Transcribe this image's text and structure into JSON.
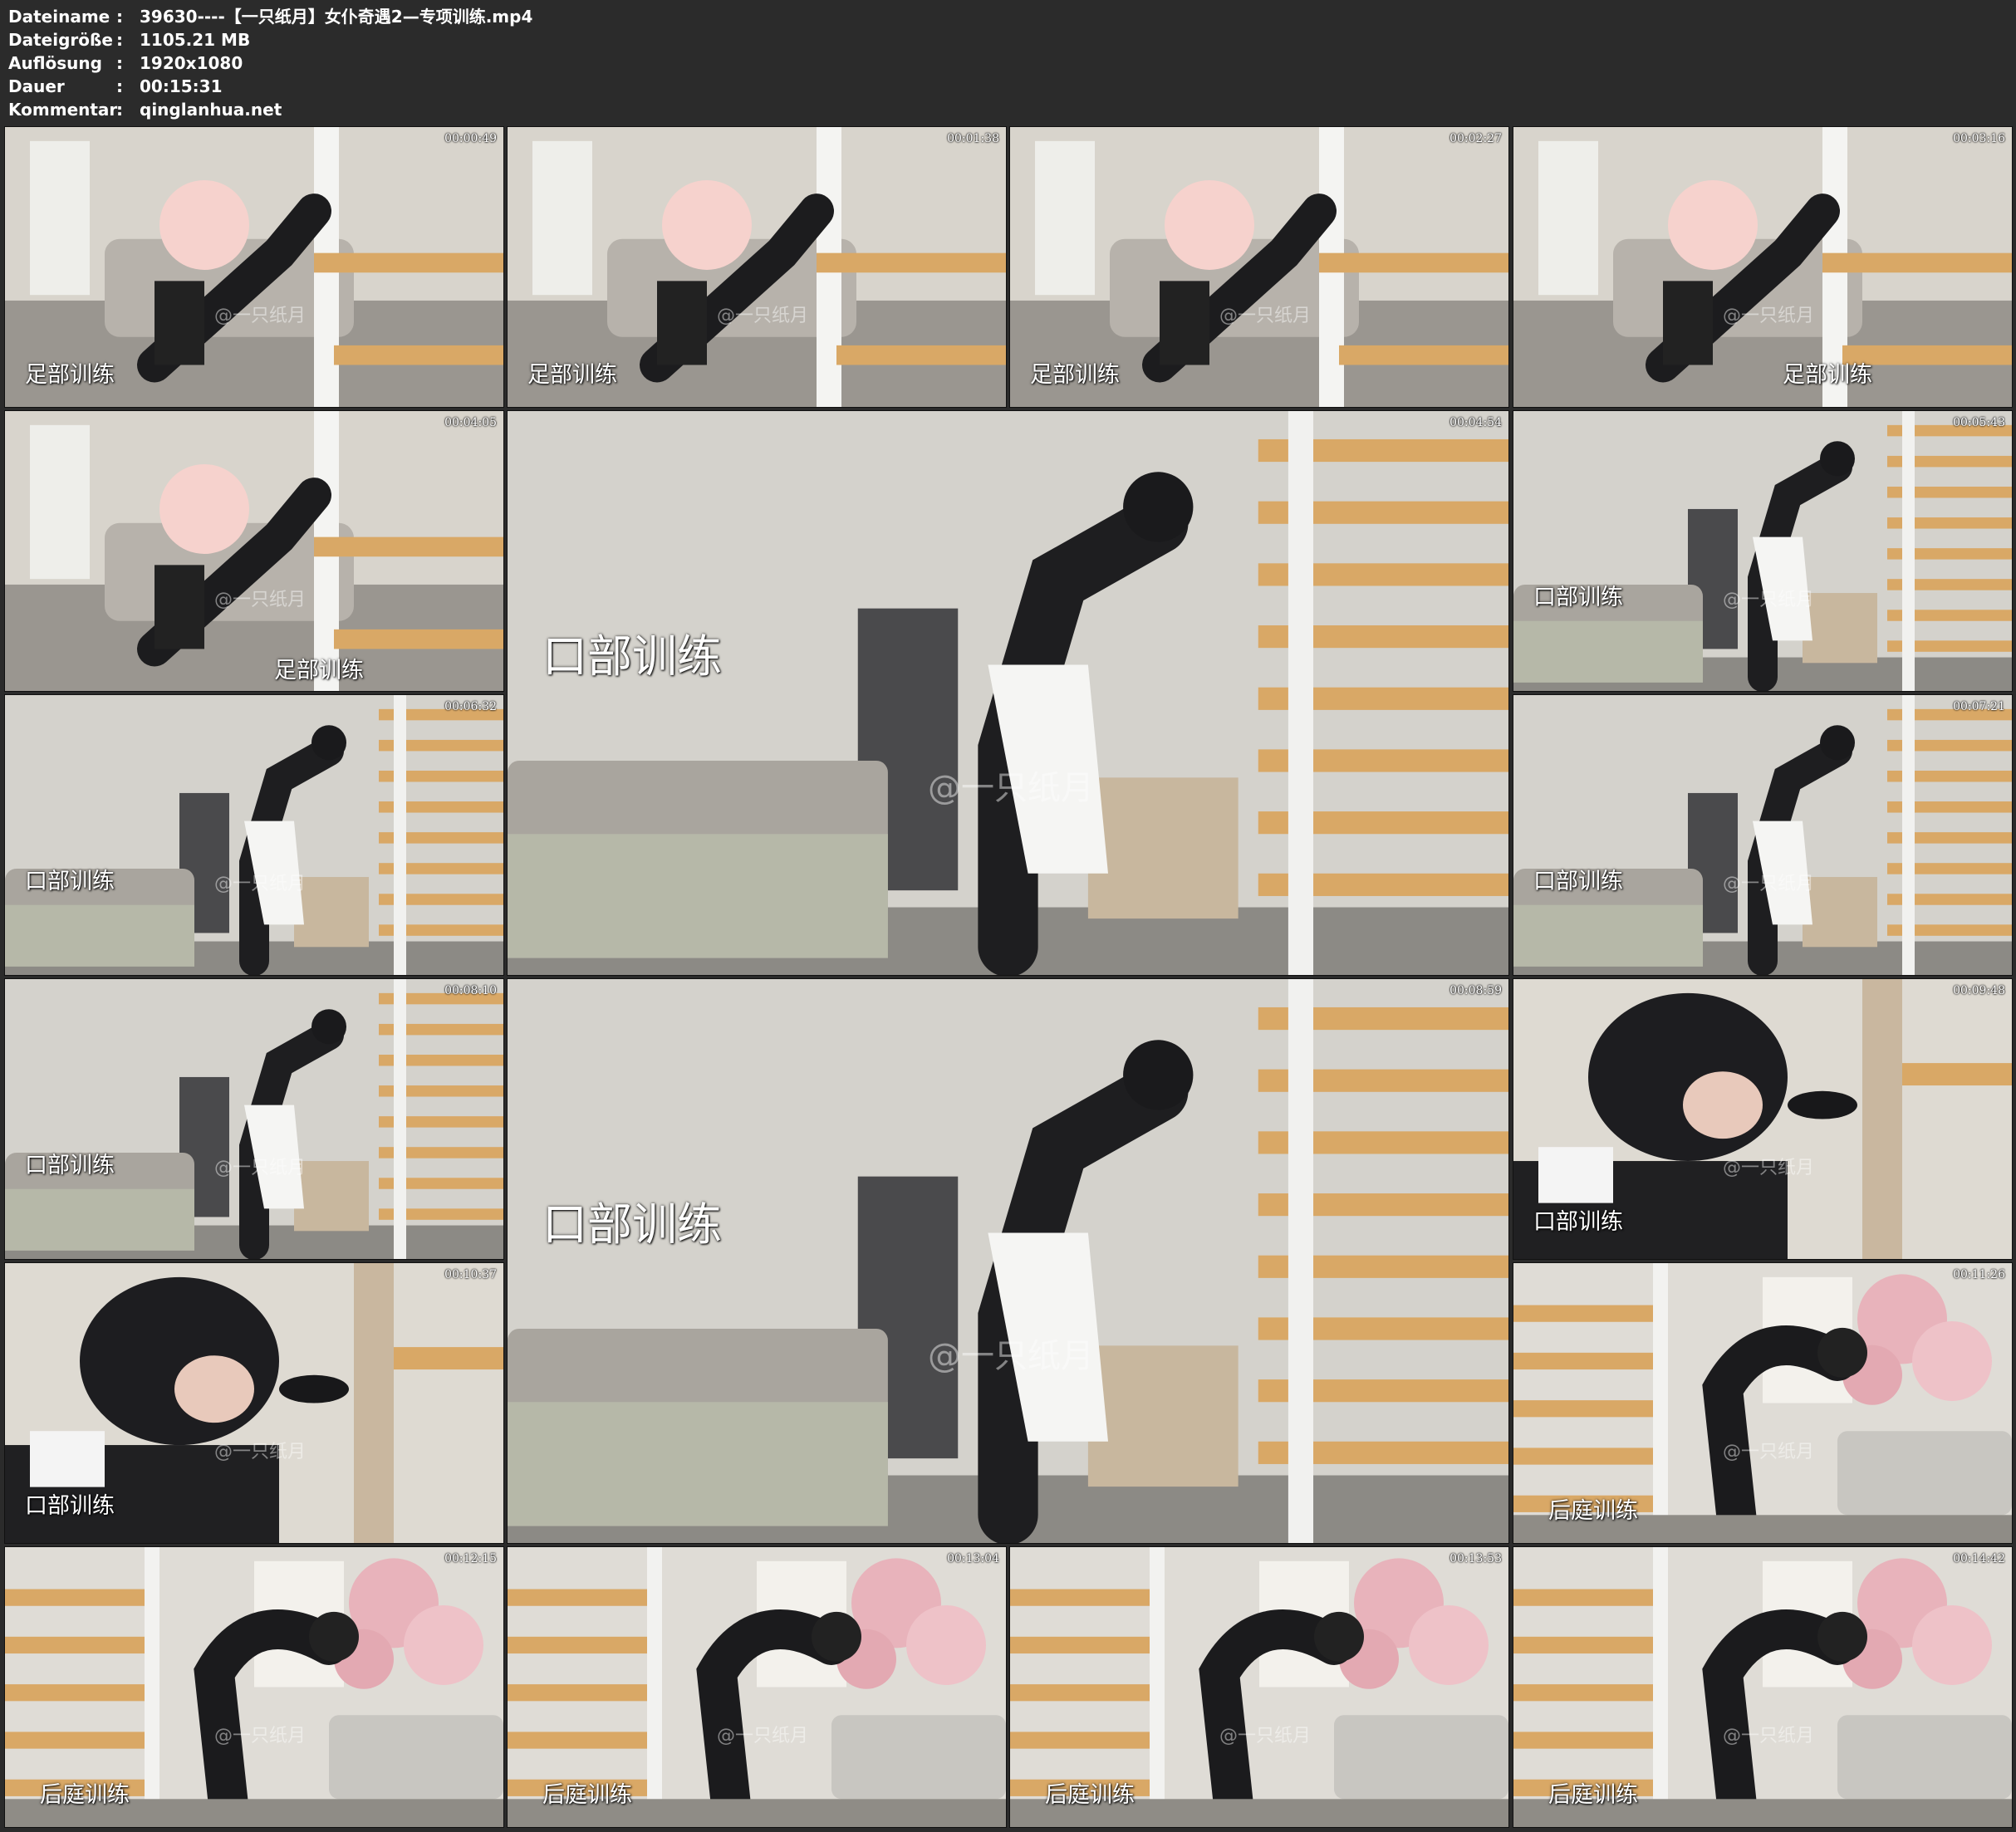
{
  "meta": {
    "filename_label": "Dateiname",
    "filename": "39630----【一只纸月】女仆奇遇2—专项训练.mp4",
    "filesize_label": "Dateigröße",
    "filesize": "1105.21 MB",
    "resolution_label": "Auflösung",
    "resolution": "1920x1080",
    "duration_label": "Dauer",
    "duration": "00:15:31",
    "comment_label": "Kommentar",
    "comment": "qinglanhua.net",
    "separator": ":"
  },
  "watermark": "@一只纸月",
  "thumbnails": [
    {
      "timestamp": "00:00:49",
      "caption": "足部训练",
      "scene": "foot"
    },
    {
      "timestamp": "00:01:38",
      "caption": "足部训练",
      "scene": "foot"
    },
    {
      "timestamp": "00:02:27",
      "caption": "足部训练",
      "scene": "foot"
    },
    {
      "timestamp": "00:03:16",
      "caption": "足部训练",
      "scene": "foot2"
    },
    {
      "timestamp": "00:04:05",
      "caption": "足部训练",
      "scene": "foot2"
    },
    {
      "timestamp": "00:04:54",
      "caption": "口部训练",
      "scene": "stairs"
    },
    {
      "timestamp": "00:05:43",
      "caption": "口部训练",
      "scene": "stairs"
    },
    {
      "timestamp": "00:06:32",
      "caption": "口部训练",
      "scene": "stairs"
    },
    {
      "timestamp": "00:07:21",
      "caption": "口部训练",
      "scene": "stairs"
    },
    {
      "timestamp": "00:08:10",
      "caption": "口部训练",
      "scene": "stairs"
    },
    {
      "timestamp": "00:08:59",
      "caption": "口部训练",
      "scene": "stairs"
    },
    {
      "timestamp": "00:09:48",
      "caption": "口部训练",
      "scene": "close"
    },
    {
      "timestamp": "00:10:37",
      "caption": "口部训练",
      "scene": "close"
    },
    {
      "timestamp": "00:11:26",
      "caption": "后庭训练",
      "scene": "flowers"
    },
    {
      "timestamp": "00:12:15",
      "caption": "后庭训练",
      "scene": "flowers"
    },
    {
      "timestamp": "00:13:04",
      "caption": "后庭训练",
      "scene": "flowers"
    },
    {
      "timestamp": "00:13:53",
      "caption": "后庭训练",
      "scene": "flowers"
    },
    {
      "timestamp": "00:14:42",
      "caption": "后庭训练",
      "scene": "flowers"
    }
  ]
}
